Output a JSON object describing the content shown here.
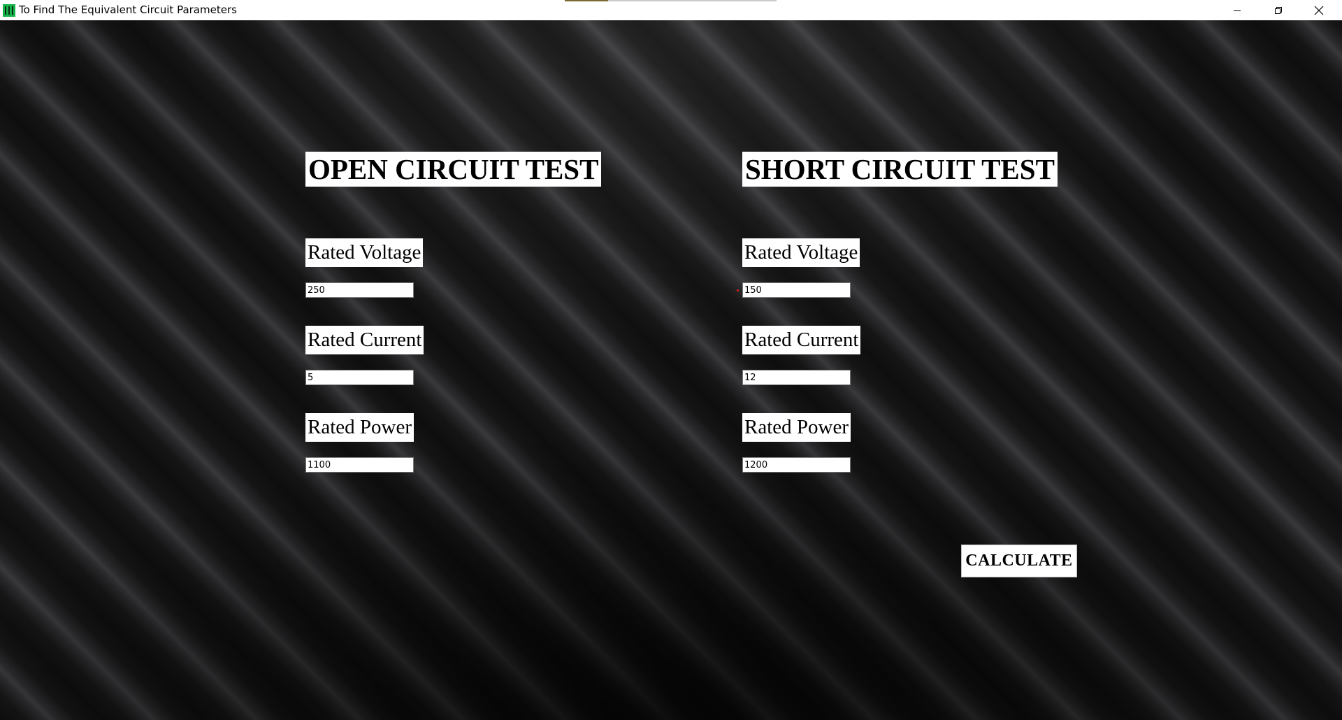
{
  "window": {
    "title": "To Find The Equivalent Circuit Parameters",
    "app_icon": "python-idle-icon",
    "controls": [
      "minimize-icon",
      "restore-icon",
      "close-icon"
    ]
  },
  "open_circuit": {
    "heading": "OPEN CIRCUIT TEST",
    "voltage_label": "Rated Voltage",
    "voltage_value": "250",
    "current_label": "Rated Current",
    "current_value": "5",
    "power_label": "Rated Power",
    "power_value": "1100"
  },
  "short_circuit": {
    "heading": "SHORT CIRCUIT TEST",
    "voltage_label": "Rated Voltage",
    "voltage_value": "150",
    "current_label": "Rated Current",
    "current_value": "12",
    "power_label": "Rated Power",
    "power_value": "1200"
  },
  "actions": {
    "calculate_label": "CALCULATE"
  },
  "colors": {
    "background": "#1b1b1c",
    "stripe_highlight": "#39393b",
    "panel": "#ffffff",
    "app_icon": "#16b34a"
  }
}
